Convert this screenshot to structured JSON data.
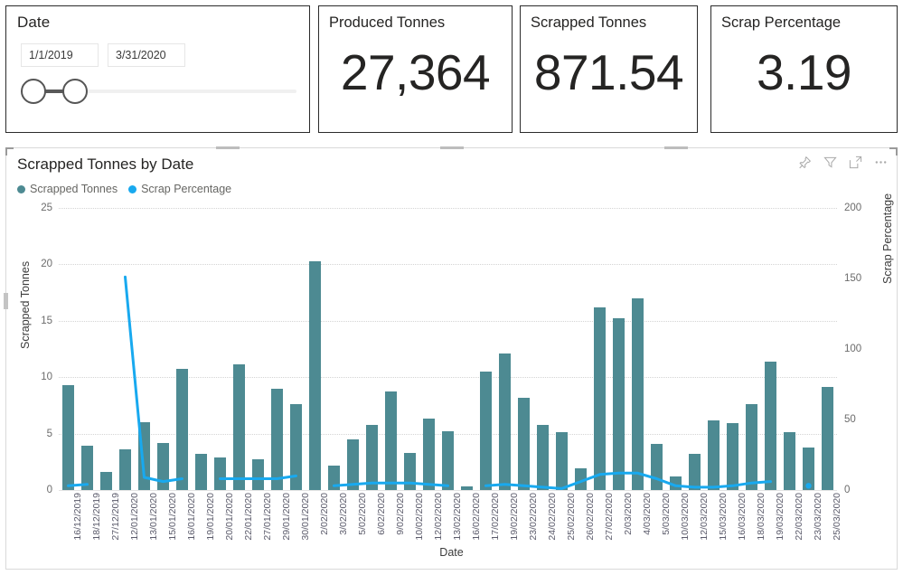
{
  "slicer": {
    "title": "Date",
    "start_value": "1/1/2019",
    "end_value": "3/31/2020"
  },
  "kpis": [
    {
      "label": "Produced Tonnes",
      "value": "27,364"
    },
    {
      "label": "Scrapped Tonnes",
      "value": "871.54"
    },
    {
      "label": "Scrap Percentage",
      "value": "3.19"
    }
  ],
  "chart_panel": {
    "title": "Scrapped Tonnes by Date",
    "icons": [
      {
        "name": "pin-icon",
        "label": "Pin to dashboard"
      },
      {
        "name": "filter-icon",
        "label": "Filters"
      },
      {
        "name": "focus-mode-icon",
        "label": "Focus mode"
      },
      {
        "name": "more-options-icon",
        "label": "More options"
      }
    ]
  },
  "colors": {
    "bar": "#4d8a92",
    "line": "#18a9ef",
    "grid": "#d4d4d4",
    "text": "#252423",
    "axis_text": "#6b6b6b"
  },
  "chart_data": {
    "type": "bar",
    "title": "Scrapped Tonnes by Date",
    "xlabel": "Date",
    "ylabel": "Scrapped Tonnes",
    "y2label": "Scrap Percentage",
    "ylim": [
      0,
      25
    ],
    "y2lim": [
      0,
      200
    ],
    "yticks": [
      0,
      5,
      10,
      15,
      20,
      25
    ],
    "y2ticks": [
      0,
      50,
      100,
      150,
      200
    ],
    "grid": true,
    "legend_position": "top-left",
    "legend": [
      "Scrapped Tonnes",
      "Scrap Percentage"
    ],
    "categories": [
      "16/12/2019",
      "18/12/2019",
      "27/12/2019",
      "12/01/2020",
      "13/01/2020",
      "15/01/2020",
      "16/01/2020",
      "19/01/2020",
      "20/01/2020",
      "22/01/2020",
      "27/01/2020",
      "29/01/2020",
      "30/01/2020",
      "2/02/2020",
      "3/02/2020",
      "5/02/2020",
      "6/02/2020",
      "9/02/2020",
      "10/02/2020",
      "12/02/2020",
      "13/02/2020",
      "16/02/2020",
      "17/02/2020",
      "19/02/2020",
      "23/02/2020",
      "24/02/2020",
      "25/02/2020",
      "26/02/2020",
      "27/02/2020",
      "2/03/2020",
      "4/03/2020",
      "5/03/2020",
      "10/03/2020",
      "12/03/2020",
      "15/03/2020",
      "16/03/2020",
      "18/03/2020",
      "19/03/2020",
      "22/03/2020",
      "23/03/2020",
      "25/03/2020"
    ],
    "series": [
      {
        "name": "Scrapped Tonnes",
        "axis": "left",
        "type": "bar",
        "color": "#4d8a92",
        "values": [
          9.3,
          3.9,
          1.6,
          3.6,
          6.0,
          4.2,
          10.7,
          3.2,
          2.9,
          11.1,
          2.7,
          9.0,
          7.6,
          20.3,
          2.2,
          4.5,
          5.8,
          8.7,
          3.3,
          6.3,
          5.2,
          0.3,
          10.5,
          12.1,
          8.2,
          5.8,
          5.1,
          1.9,
          16.2,
          15.2,
          17.0,
          4.1,
          1.2,
          3.2,
          6.2,
          5.9,
          7.6,
          11.4,
          5.1,
          3.8,
          9.1
        ]
      },
      {
        "name": "Scrap Percentage",
        "axis": "right",
        "type": "line",
        "color": "#18a9ef",
        "values": [
          3.0,
          4.0,
          null,
          151.0,
          9.0,
          6.0,
          8.0,
          null,
          8.0,
          8.0,
          8.0,
          8.0,
          10.0,
          null,
          3.0,
          4.0,
          5.0,
          5.0,
          5.0,
          4.0,
          3.0,
          null,
          3.0,
          4.0,
          3.0,
          2.0,
          1.0,
          6.0,
          11.0,
          12.0,
          12.0,
          8.0,
          3.0,
          2.0,
          2.0,
          3.0,
          5.0,
          6.0,
          null,
          3.0,
          null
        ]
      }
    ]
  }
}
